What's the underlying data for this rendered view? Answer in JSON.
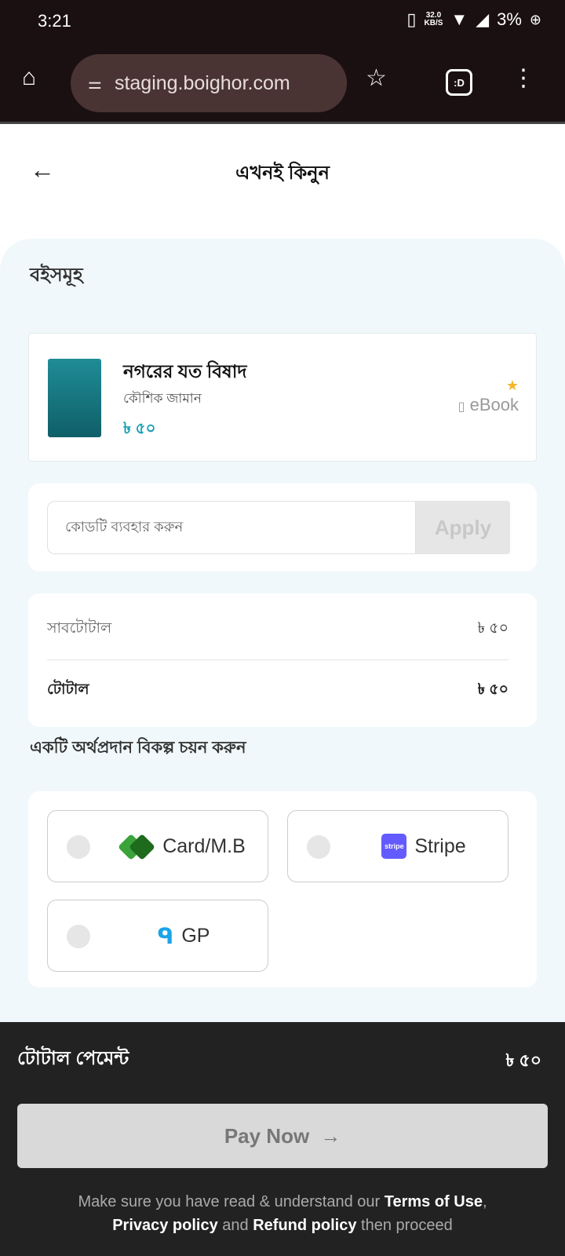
{
  "status_bar": {
    "time": "3:21",
    "speed_value": "32.0",
    "speed_unit": "KB/S",
    "battery": "3%"
  },
  "browser": {
    "url": "staging.boighor.com",
    "tabs_label": ":D"
  },
  "header": {
    "title": "এখনই কিনুন"
  },
  "books_section": {
    "heading": "বইসমূহ",
    "items": [
      {
        "title": "নগরের যত বিষাদ",
        "author": "কৌশিক জামান",
        "price": "৳ ৫০",
        "format": "eBook"
      }
    ]
  },
  "coupon": {
    "placeholder": "কোডটি ব্যবহার করুন",
    "apply_label": "Apply"
  },
  "summary": {
    "subtotal_label": "সাবটোটাল",
    "subtotal_value": "৳ ৫০",
    "total_label": "টোটাল",
    "total_value": "৳ ৫০"
  },
  "payment": {
    "heading": "একটি অর্থপ্রদান বিকল্প চয়ন করুন",
    "options": [
      {
        "label": "Card/M.B",
        "icon": "card-mb-logo"
      },
      {
        "label": "Stripe",
        "icon": "stripe-logo",
        "logo_text": "stripe"
      },
      {
        "label": "GP",
        "icon": "grameenphone-logo"
      }
    ]
  },
  "footer": {
    "total_label": "টোটাল পেমেন্ট",
    "total_value": "৳ ৫০",
    "pay_label": "Pay Now",
    "terms": {
      "t1": "Make sure you have read & understand our ",
      "terms": "Terms of Use",
      "comma": ",",
      "privacy": "Privacy policy",
      "and": " and ",
      "refund": "Refund policy",
      "end": " then proceed"
    }
  },
  "colors": {
    "accent": "#19a0b0",
    "background": "#f1f8fb",
    "footer": "#222222"
  }
}
